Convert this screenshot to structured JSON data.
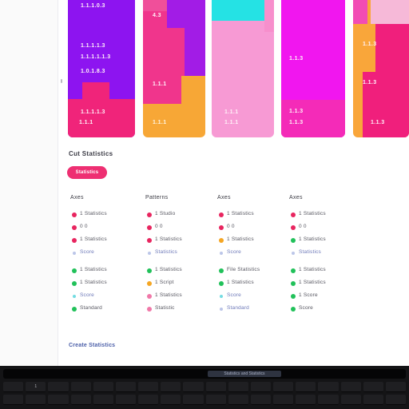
{
  "cards": [
    {
      "lines": [
        "1.1.1.0.3",
        "1.1.1.1.3",
        "1.1.1.1.1.3",
        "1.0.1.8.3",
        "1.1.1.1.3",
        "1.1.1"
      ]
    },
    {
      "lines": [
        "4.3",
        "1.1.1",
        "1.1.1"
      ]
    },
    {
      "lines": [
        "1.1.1",
        "1.1.1"
      ]
    },
    {
      "lines": [
        "1.1.3",
        "1.1.3",
        "1.1.3"
      ]
    },
    {
      "lines": [
        "1.1.3",
        "1.1.3",
        "1.1.3"
      ]
    }
  ],
  "section": {
    "title": "Cut Statistics",
    "button": "Statistics"
  },
  "columns": [
    {
      "header": "Axes",
      "rows": [
        {
          "label": "1 Statistics",
          "color": "#e8255f"
        },
        {
          "label": "0 0",
          "color": "#e8255f"
        },
        {
          "label": "1 Statistics",
          "color": "#e8255f"
        },
        {
          "label": "Score",
          "color": "#8fa0d8",
          "link": true
        },
        {
          "label": "1 Statistics",
          "color": "#21c15a"
        },
        {
          "label": "1 Statistics",
          "color": "#21c15a"
        },
        {
          "label": "Score",
          "color": "#17c4cf",
          "link": true
        },
        {
          "label": "Standard",
          "color": "#21c15a"
        }
      ]
    },
    {
      "header": "Patterns",
      "rows": [
        {
          "label": "1 Studio",
          "color": "#e8255f"
        },
        {
          "label": "0 0",
          "color": "#e8255f"
        },
        {
          "label": "1 Statistics",
          "color": "#e8255f"
        },
        {
          "label": "Statistics",
          "color": "#8fa0d8",
          "link": true
        },
        {
          "label": "1 Statistics",
          "color": "#21c15a"
        },
        {
          "label": "1 Script",
          "color": "#f5a623"
        },
        {
          "label": "1 Statistics",
          "color": "#f078a8"
        },
        {
          "label": "Statistic",
          "color": "#f078a8"
        }
      ]
    },
    {
      "header": "Axes",
      "rows": [
        {
          "label": "1 Statistics",
          "color": "#e8255f"
        },
        {
          "label": "0 0",
          "color": "#e8255f"
        },
        {
          "label": "1 Statistics",
          "color": "#f5a623"
        },
        {
          "label": "Score",
          "color": "#8fa0d8",
          "link": true
        },
        {
          "label": "File Statistics",
          "color": "#21c15a"
        },
        {
          "label": "1 Statistics",
          "color": "#21c15a"
        },
        {
          "label": "Score",
          "color": "#17c4cf",
          "link": true
        },
        {
          "label": "Standard",
          "color": "#8fa0d8",
          "link": true
        }
      ]
    },
    {
      "header": "Axes",
      "rows": [
        {
          "label": "1 Statistics",
          "color": "#e8255f"
        },
        {
          "label": "0 0",
          "color": "#e8255f"
        },
        {
          "label": "1 Statistics",
          "color": "#21c15a"
        },
        {
          "label": "Statistics",
          "color": "#8fa0d8",
          "link": true
        },
        {
          "label": "1 Statistics",
          "color": "#21c15a"
        },
        {
          "label": "1 Statistics",
          "color": "#21c15a"
        },
        {
          "label": "1 Score",
          "color": "#21c15a"
        },
        {
          "label": "Score",
          "color": "#21c15a"
        }
      ]
    }
  ],
  "footer": {
    "link": "Create Statistics"
  },
  "touchbar": {
    "label": "Statistics and Statistics"
  },
  "keyboard": {
    "row1": [
      "",
      "1",
      "",
      "",
      "",
      "",
      "",
      "",
      "",
      "",
      "",
      "",
      "",
      "",
      "",
      "",
      "",
      ""
    ],
    "row2": [
      "",
      "",
      "",
      "",
      "",
      "",
      "",
      "",
      "",
      "",
      "",
      "",
      "",
      "",
      "",
      "",
      "",
      ""
    ],
    "row3": [
      "",
      "",
      "",
      "",
      "",
      "",
      "",
      "",
      "",
      "",
      "",
      "",
      "",
      "",
      "",
      "",
      "",
      ""
    ]
  }
}
